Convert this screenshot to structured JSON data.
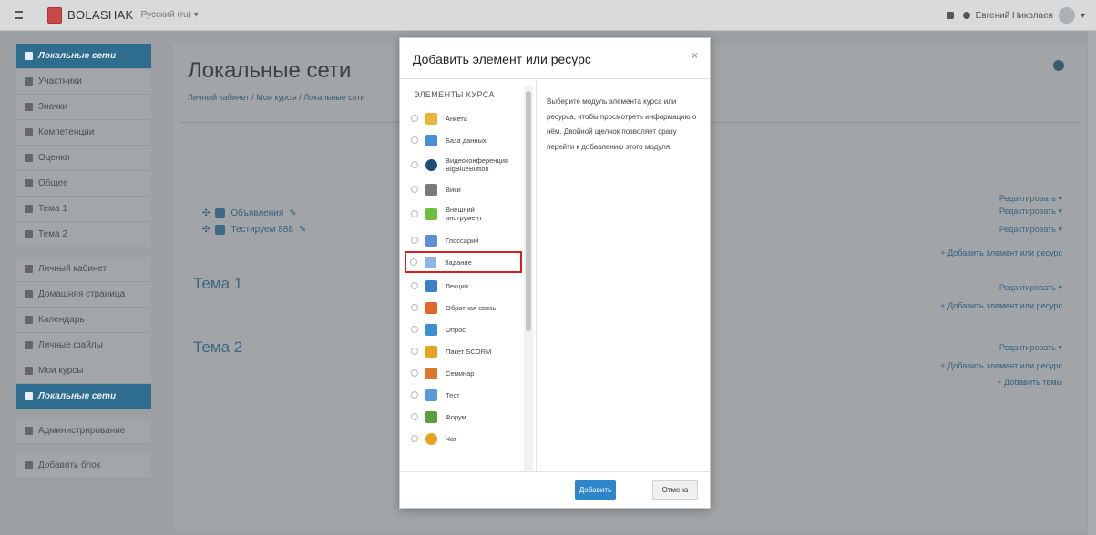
{
  "header": {
    "brand": "BOLASHAK",
    "language": "Русский (ru) ▾",
    "user_name": "Евгений Николаев",
    "menu_caret": "▾"
  },
  "drawer": {
    "course_nav": [
      {
        "label": "Локальные сети",
        "active": true
      },
      {
        "label": "Участники"
      },
      {
        "label": "Значки"
      },
      {
        "label": "Компетенции"
      },
      {
        "label": "Оценки"
      },
      {
        "label": "Общее"
      },
      {
        "label": "Тема 1"
      },
      {
        "label": "Тема 2"
      }
    ],
    "site_nav": [
      {
        "label": "Личный кабинет"
      },
      {
        "label": "Домашняя страница"
      },
      {
        "label": "Календарь"
      },
      {
        "label": "Личные файлы"
      },
      {
        "label": "Мои курсы"
      },
      {
        "label": "Локальные сети",
        "active": true
      }
    ],
    "admin": "Администрирование",
    "add_block": "Добавить блок"
  },
  "main": {
    "title": "Локальные сети",
    "breadcrumb": "Личный кабинет / Мои курсы / Локальные сети",
    "activities": [
      "Объявления",
      "Тестируем 888"
    ],
    "sections": [
      "Тема 1",
      "Тема 2"
    ],
    "edit_label": "Редактировать ▾",
    "add_activity": "Добавить элемент или ресурс",
    "add_topics": "Добавить темы"
  },
  "modal": {
    "title": "Добавить элемент или ресурс",
    "close": "×",
    "category": "ЭЛЕМЕНТЫ КУРСА",
    "description": "Выберите модуль элемента курса или ресурса, чтобы просмотреть информацию о нём. Двойной щелчок позволяет сразу перейти к добавлению этого модуля.",
    "items": [
      {
        "label": "Анкета",
        "icon": "survey-icon",
        "color": "#e8b53a"
      },
      {
        "label": "База данных",
        "icon": "database-icon",
        "color": "#4a90d9"
      },
      {
        "label": "Видеоконференция BigBlueButton",
        "icon": "bigbluebutton-icon",
        "color": "#1e4b7a"
      },
      {
        "label": "Вики",
        "icon": "wiki-icon",
        "color": "#7a7a7a"
      },
      {
        "label": "Внешний инструмент",
        "icon": "puzzle-icon",
        "color": "#6dbf3a"
      },
      {
        "label": "Глоссарий",
        "icon": "glossary-icon",
        "color": "#5b8fd6"
      },
      {
        "label": "Задание",
        "icon": "assignment-icon",
        "color": "#8fb5e8",
        "highlighted": true
      },
      {
        "label": "Лекция",
        "icon": "lesson-icon",
        "color": "#3c7fc9"
      },
      {
        "label": "Обратная связь",
        "icon": "feedback-icon",
        "color": "#e0662a"
      },
      {
        "label": "Опрос",
        "icon": "choice-icon",
        "color": "#3a8fd0"
      },
      {
        "label": "Пакет SCORM",
        "icon": "scorm-icon",
        "color": "#e8a31e"
      },
      {
        "label": "Семинар",
        "icon": "workshop-icon",
        "color": "#d87a2a"
      },
      {
        "label": "Тест",
        "icon": "quiz-icon",
        "color": "#5a9ad8"
      },
      {
        "label": "Форум",
        "icon": "forum-icon",
        "color": "#5aa03a"
      },
      {
        "label": "Чат",
        "icon": "chat-icon",
        "color": "#e8a31e"
      }
    ],
    "add_button": "Добавить",
    "cancel_button": "Отмена"
  }
}
